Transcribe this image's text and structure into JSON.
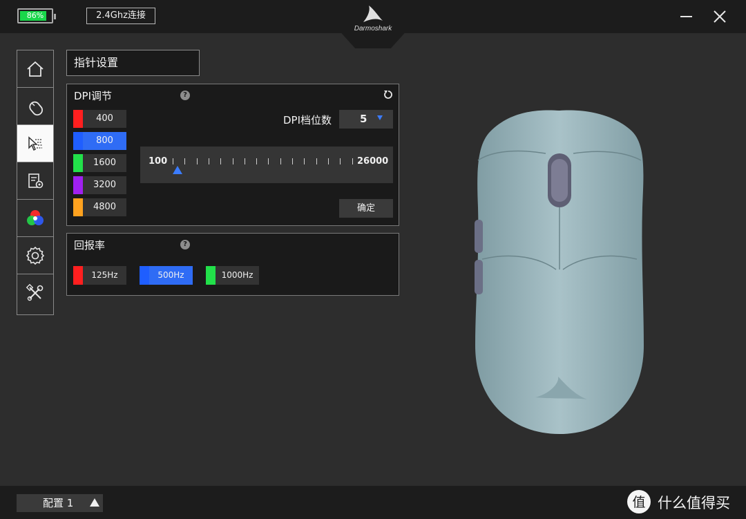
{
  "header": {
    "battery_text": "86%",
    "battery_level": 0.86,
    "connection_label": "2.4Ghz连接",
    "brand": "Darmoshark"
  },
  "sidebar": {
    "items": [
      {
        "icon": "home-icon"
      },
      {
        "icon": "mouse-icon"
      },
      {
        "icon": "pointer-settings-icon",
        "active": true
      },
      {
        "icon": "macro-icon"
      },
      {
        "icon": "rgb-light-icon"
      },
      {
        "icon": "gear-icon"
      },
      {
        "icon": "tools-icon"
      }
    ]
  },
  "page_title": "指针设置",
  "dpi": {
    "title": "DPI调节",
    "help": "?",
    "levels": [
      {
        "value": "400",
        "color": "#ff1f1f"
      },
      {
        "value": "800",
        "color": "#1f5eff",
        "selected": true
      },
      {
        "value": "1600",
        "color": "#22e04a"
      },
      {
        "value": "3200",
        "color": "#a020f0"
      },
      {
        "value": "4800",
        "color": "#ffa21f"
      }
    ],
    "count_label": "DPI档位数",
    "count_value": "5",
    "slider_min": "100",
    "slider_max": "26000",
    "slider_value": 800,
    "confirm_label": "确定"
  },
  "polling": {
    "title": "回报率",
    "help": "?",
    "rates": [
      {
        "value": "125Hz",
        "color": "#ff1f1f"
      },
      {
        "value": "500Hz",
        "color": "#1f5eff",
        "selected": true
      },
      {
        "value": "1000Hz",
        "color": "#22e04a"
      }
    ]
  },
  "footer": {
    "profile_label": "配置 1",
    "watermark_glyph": "值",
    "watermark_text": "什么值得买"
  },
  "colors": {
    "accent": "#2f6cf5",
    "background": "#2d2d2d",
    "bar": "#1c1c1c"
  }
}
